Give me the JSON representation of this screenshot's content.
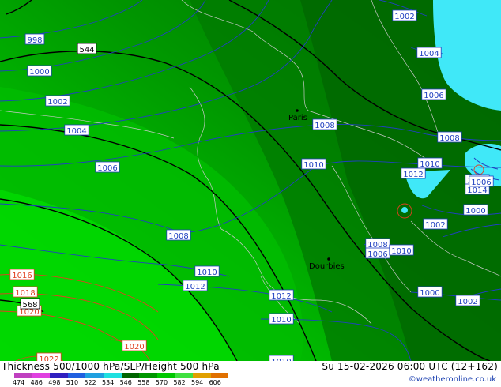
{
  "map": {
    "city_labels": [
      {
        "name": "Paris"
      },
      {
        "name": "Dourbies"
      }
    ],
    "isobars": [
      {
        "value": "998"
      },
      {
        "value": "1000"
      },
      {
        "value": "1002"
      },
      {
        "value": "1004"
      },
      {
        "value": "1006"
      },
      {
        "value": "1008"
      },
      {
        "value": "1010"
      },
      {
        "value": "1012"
      },
      {
        "value": "1014"
      },
      {
        "value": "1016"
      },
      {
        "value": "1018"
      },
      {
        "value": "1020"
      },
      {
        "value": "1022"
      }
    ],
    "height_contours": [
      {
        "value": "544"
      },
      {
        "value": "568"
      }
    ],
    "colors": {
      "thickness_low": "#00c800",
      "thickness_mid": "#009600",
      "thickness_high": "#006400",
      "cold_cyan": "#40e8f8",
      "isobar_line": "#2040c0",
      "high_pressure_line": "#e04020",
      "height_contour": "#000000",
      "border_line": "#c8c8c8"
    }
  },
  "footer": {
    "title": "Thickness 500/1000 hPa/SLP/Height 500 hPa",
    "datetime": "Su 15-02-2026 06:00 UTC (12+162)",
    "credit": "©weatheronline.co.uk",
    "legend": {
      "ticks": [
        "474",
        "486",
        "498",
        "510",
        "522",
        "534",
        "546",
        "558",
        "570",
        "582",
        "594",
        "606"
      ],
      "colors": [
        "#c040c0",
        "#e040e0",
        "#3020c0",
        "#2060e0",
        "#20a0e0",
        "#20e0e0",
        "#006400",
        "#009600",
        "#00c800",
        "#40e040",
        "#e0a000",
        "#e07000"
      ]
    }
  }
}
